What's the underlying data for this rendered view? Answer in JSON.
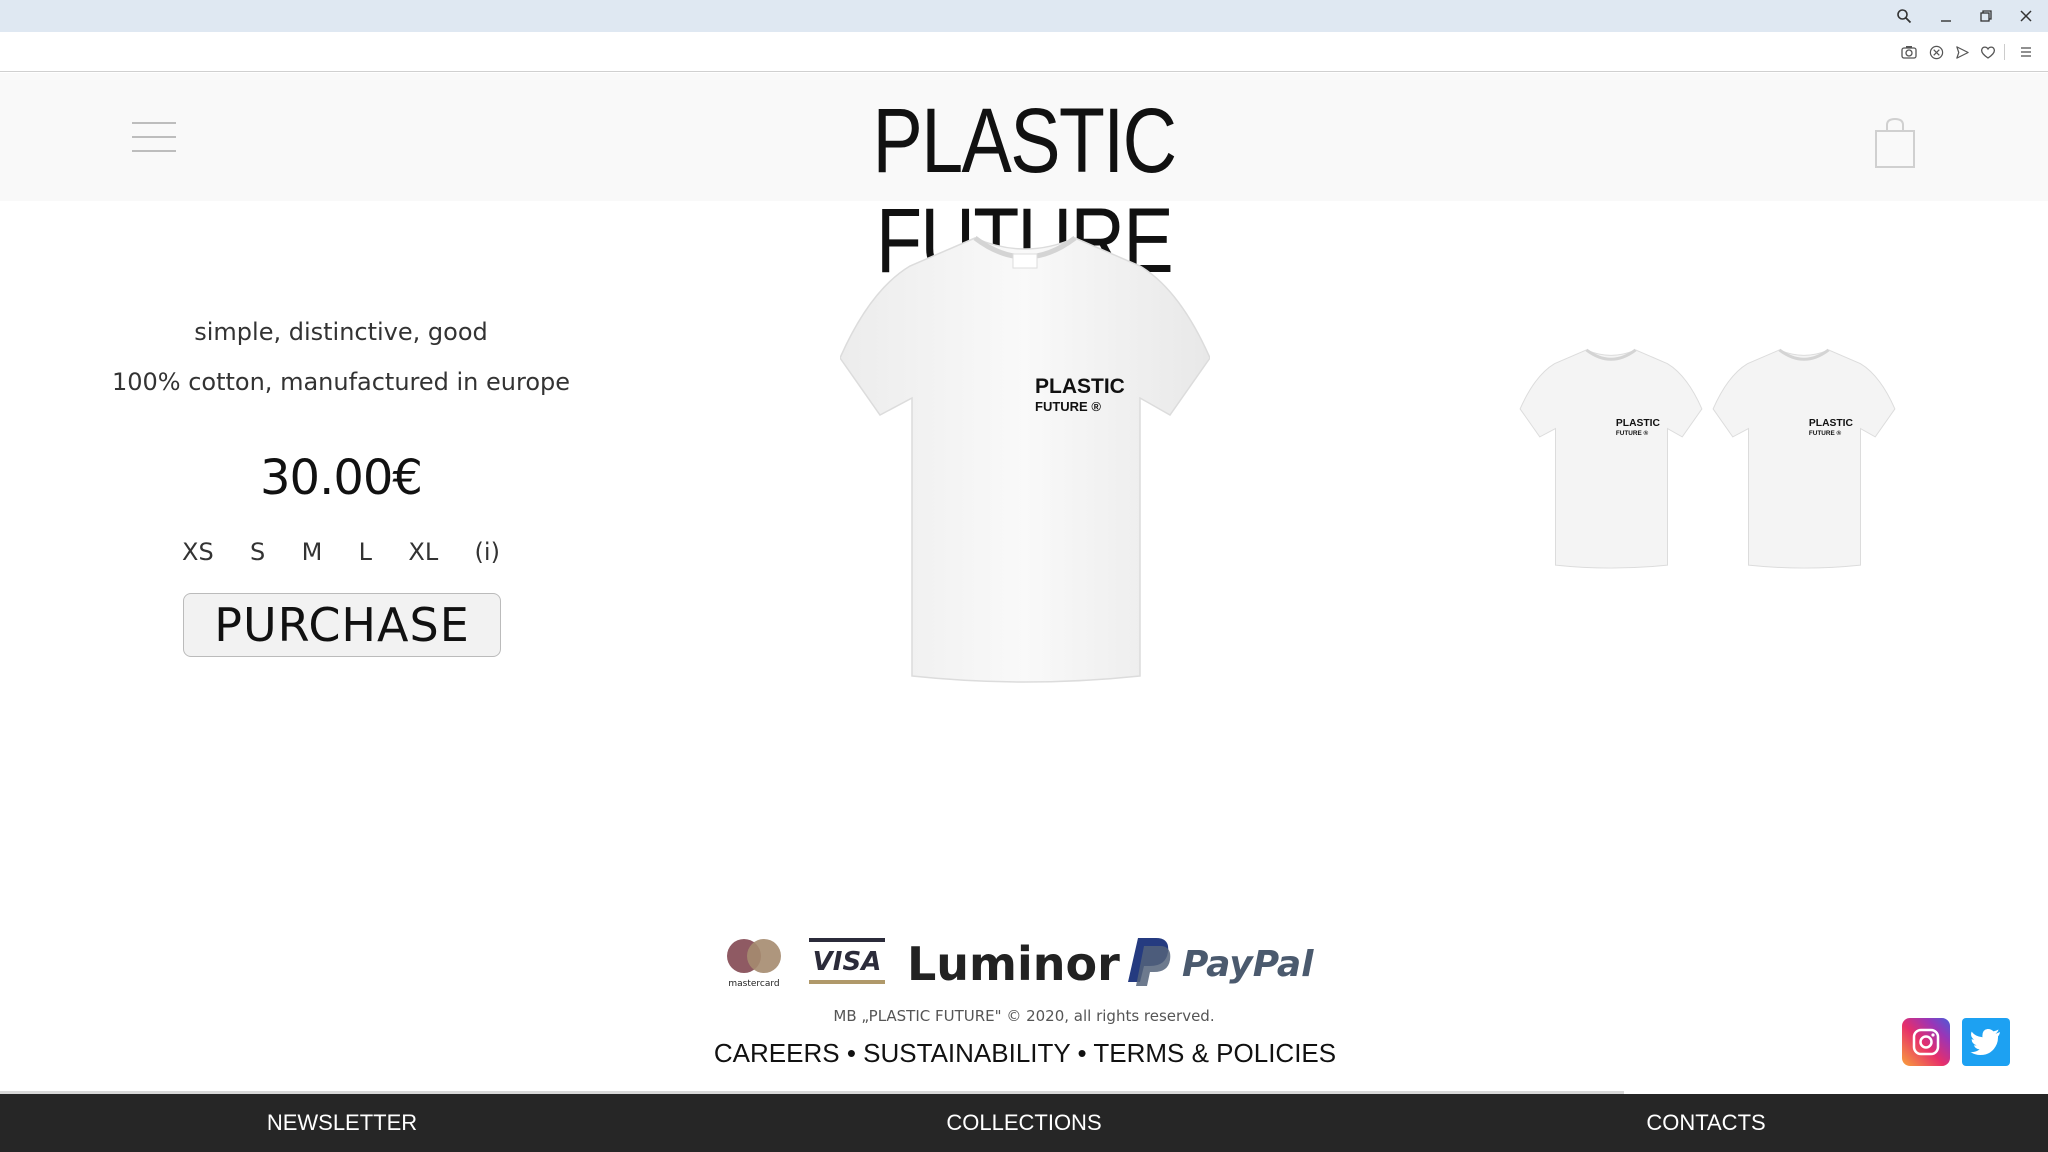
{
  "window": {
    "controls": [
      "search-icon",
      "minimize-icon",
      "restore-icon",
      "close-icon"
    ]
  },
  "toolbar": {
    "icons": [
      "camera-icon",
      "shield-icon",
      "send-icon",
      "heart-icon",
      "menu-icon"
    ]
  },
  "header": {
    "brand": "PLASTIC FUTURE"
  },
  "product": {
    "tagline_1": "simple, distinctive, good",
    "tagline_2": "100% cotton, manufactured in europe",
    "price": "30.00€",
    "sizes": [
      "XS",
      "S",
      "M",
      "L",
      "XL",
      "(i)"
    ],
    "purchase_label": "PURCHASE",
    "print_line_1": "PLASTIC",
    "print_line_2": "FUTURE ®"
  },
  "footer": {
    "payments": {
      "mastercard": "mastercard",
      "visa": "VISA",
      "luminor": "Luminor",
      "paypal": "PayPal"
    },
    "copyright": "MB „PLASTIC FUTURE\" © 2020, all rights reserved.",
    "links": {
      "careers": "CAREERS",
      "sustainability": "SUSTAINABILITY",
      "terms": "TERMS & POLICIES",
      "separator": "•"
    },
    "social": [
      "instagram-icon",
      "twitter-icon"
    ]
  },
  "bottom_nav": {
    "newsletter": "NEWSLETTER",
    "collections": "COLLECTIONS",
    "contacts": "CONTACTS"
  }
}
